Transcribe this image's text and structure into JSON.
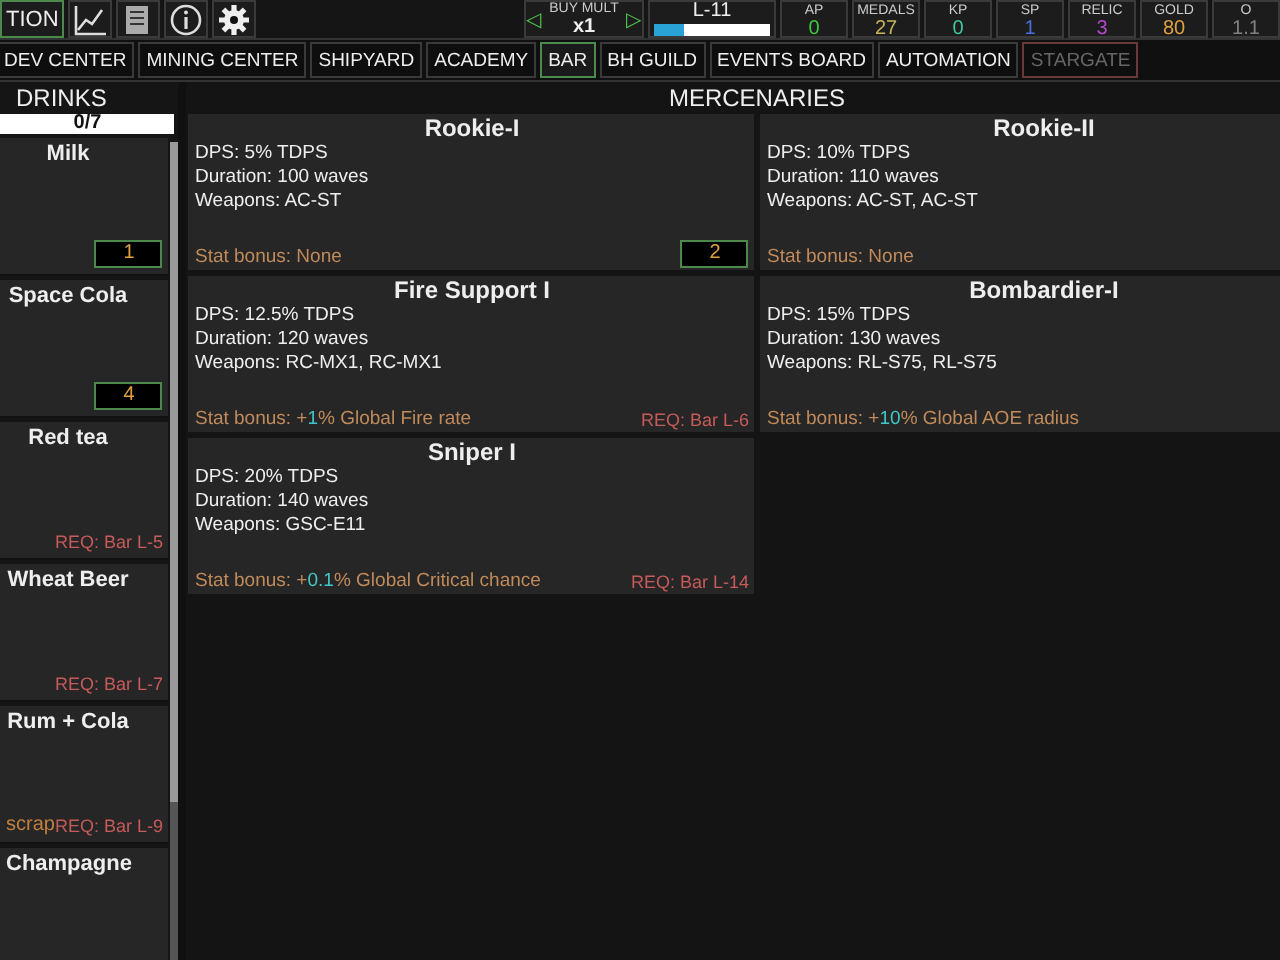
{
  "top_bar": {
    "menu_button": "TION",
    "buy_mult": {
      "label": "BUY MULT",
      "value": "x1",
      "left_arrow": "◁",
      "right_arrow": "▷"
    },
    "level": {
      "label": "L-11",
      "level": 0.25
    },
    "stats": [
      {
        "label": "AP",
        "value": "0",
        "color": "#3fc83f"
      },
      {
        "label": "MEDALS",
        "value": "27",
        "color": "#c8b45a"
      },
      {
        "label": "KP",
        "value": "0",
        "color": "#3fc8a0"
      },
      {
        "label": "SP",
        "value": "1",
        "color": "#4a6ee0"
      },
      {
        "label": "RELIC",
        "value": "3",
        "color": "#b048d0"
      },
      {
        "label": "GOLD",
        "value": "80",
        "color": "#e0a040"
      },
      {
        "label": "O",
        "value": "1.1",
        "color": "#808080"
      }
    ]
  },
  "tabs": [
    {
      "label": "DEV CENTER",
      "selected": false,
      "disabled": false
    },
    {
      "label": "MINING CENTER",
      "selected": false,
      "disabled": false
    },
    {
      "label": "SHIPYARD",
      "selected": false,
      "disabled": false
    },
    {
      "label": "ACADEMY",
      "selected": false,
      "disabled": false
    },
    {
      "label": "BAR",
      "selected": true,
      "disabled": false
    },
    {
      "label": "BH GUILD",
      "selected": false,
      "disabled": false
    },
    {
      "label": "EVENTS BOARD",
      "selected": false,
      "disabled": false
    },
    {
      "label": "AUTOMATION",
      "selected": false,
      "disabled": false
    },
    {
      "label": "STARGATE",
      "selected": false,
      "disabled": true
    }
  ],
  "drinks": {
    "title": "DRINKS",
    "progress": "0/7",
    "items": [
      {
        "name": "Milk",
        "count": "1"
      },
      {
        "name": "Space Cola",
        "count": "4"
      },
      {
        "name": "Red tea",
        "requirement": "REQ: Bar L-5"
      },
      {
        "name": "Wheat Beer",
        "requirement": "REQ: Bar L-7"
      },
      {
        "name": "Rum + Cola",
        "requirement": "REQ: Bar L-9",
        "note": "scrap"
      },
      {
        "name": "Champagne"
      }
    ]
  },
  "mercenaries": {
    "title": "MERCENARIES",
    "items": [
      {
        "name": "Rookie-I",
        "dps": "DPS: 5% TDPS",
        "duration": "Duration: 100 waves",
        "weapons": "Weapons: AC-ST",
        "stat_bonus": [
          {
            "text": "Stat bonus: None",
            "highlight": false
          }
        ],
        "count": "2"
      },
      {
        "name": "Rookie-II",
        "dps": "DPS: 10% TDPS",
        "duration": "Duration: 110 waves",
        "weapons": "Weapons: AC-ST, AC-ST",
        "stat_bonus": [
          {
            "text": "Stat bonus: None",
            "highlight": false
          }
        ]
      },
      {
        "name": "Fire Support I",
        "dps": "DPS: 12.5% TDPS",
        "duration": "Duration: 120 waves",
        "weapons": "Weapons: RC-MX1, RC-MX1",
        "stat_bonus": [
          {
            "text": "Stat bonus: +",
            "highlight": false
          },
          {
            "text": "1",
            "highlight": true
          },
          {
            "text": "% Global Fire rate",
            "highlight": false
          }
        ],
        "requirement": "REQ: Bar L-6"
      },
      {
        "name": "Bombardier-I",
        "dps": "DPS: 15% TDPS",
        "duration": "Duration: 130 waves",
        "weapons": "Weapons: RL-S75, RL-S75",
        "stat_bonus": [
          {
            "text": "Stat bonus: +",
            "highlight": false
          },
          {
            "text": "10",
            "highlight": true
          },
          {
            "text": "% Global AOE radius",
            "highlight": false
          }
        ]
      },
      {
        "name": "Sniper I",
        "dps": "DPS: 20% TDPS",
        "duration": "Duration: 140 waves",
        "weapons": "Weapons: GSC-E11",
        "stat_bonus": [
          {
            "text": "Stat bonus: +",
            "highlight": false
          },
          {
            "text": "0.1",
            "highlight": true
          },
          {
            "text": "% Global Critical chance",
            "highlight": false
          }
        ],
        "requirement": "REQ: Bar L-14"
      }
    ]
  }
}
